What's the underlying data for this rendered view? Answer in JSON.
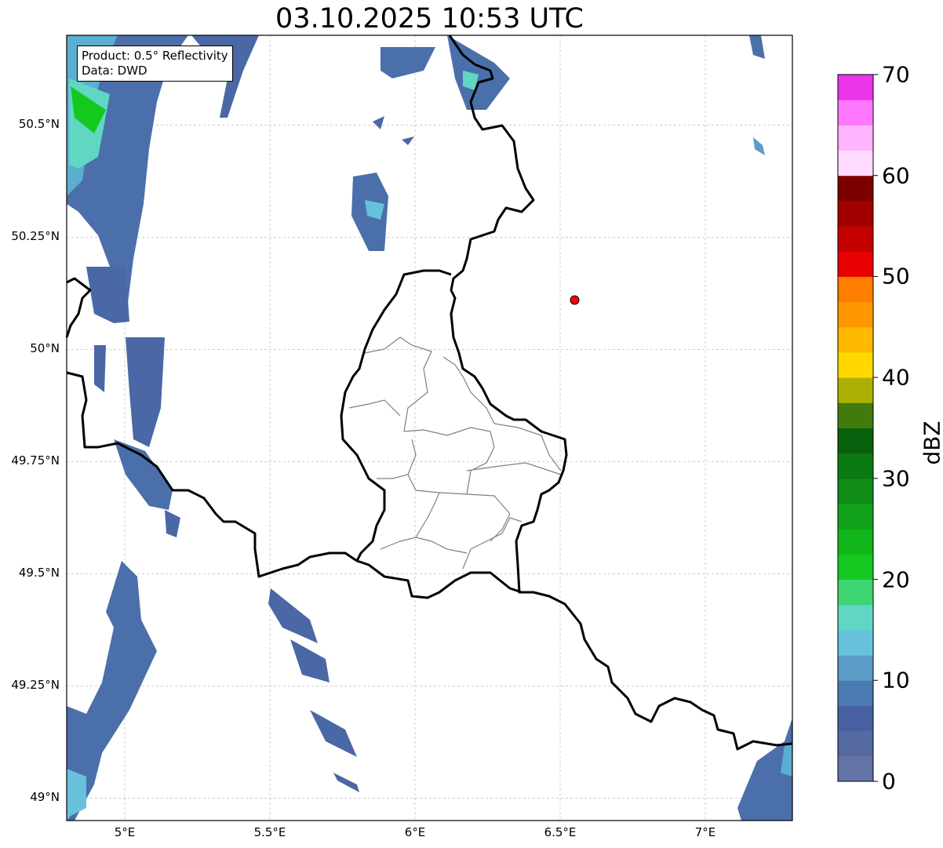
{
  "title": "03.10.2025 10:53 UTC",
  "infobox": {
    "product": "Product: 0.5° Reflectivity",
    "source": "Data: DWD"
  },
  "map": {
    "lon_range": [
      4.8,
      7.3
    ],
    "lat_range": [
      48.95,
      50.7
    ],
    "x_ticks": [
      {
        "value": 5.0,
        "label": "5°E"
      },
      {
        "value": 5.5,
        "label": "5.5°E"
      },
      {
        "value": 6.0,
        "label": "6°E"
      },
      {
        "value": 6.5,
        "label": "6.5°E"
      },
      {
        "value": 7.0,
        "label": "7°E"
      }
    ],
    "y_ticks": [
      {
        "value": 50.5,
        "label": "50.5°N"
      },
      {
        "value": 50.25,
        "label": "50.25°N"
      },
      {
        "value": 50.0,
        "label": "50°N"
      },
      {
        "value": 49.75,
        "label": "49.75°N"
      },
      {
        "value": 49.5,
        "label": "49.5°N"
      },
      {
        "value": 49.25,
        "label": "49.25°N"
      },
      {
        "value": 49.0,
        "label": "49°N"
      }
    ],
    "grid": true,
    "marker": {
      "lon": 6.55,
      "lat": 50.11,
      "color": "#ff0000"
    }
  },
  "colorbar": {
    "label": "dBZ",
    "min": 0,
    "max": 70,
    "step": 2.5,
    "tick_labels": [
      "0",
      "10",
      "20",
      "30",
      "40",
      "50",
      "60",
      "70"
    ],
    "colors": [
      "#6474a8",
      "#546aa0",
      "#4660a2",
      "#4b7bb3",
      "#5b9dc6",
      "#67c1db",
      "#60d6c3",
      "#3dd672",
      "#13c81f",
      "#12b51a",
      "#11a11a",
      "#0f8d17",
      "#0b7a12",
      "#08610c",
      "#437a0c",
      "#abaf04",
      "#ffd800",
      "#ffb900",
      "#ff9800",
      "#ff7d00",
      "#e80000",
      "#c40000",
      "#a00000",
      "#7d0000",
      "#ffdcff",
      "#ffb4ff",
      "#ff78ff",
      "#ea36ea"
    ]
  }
}
